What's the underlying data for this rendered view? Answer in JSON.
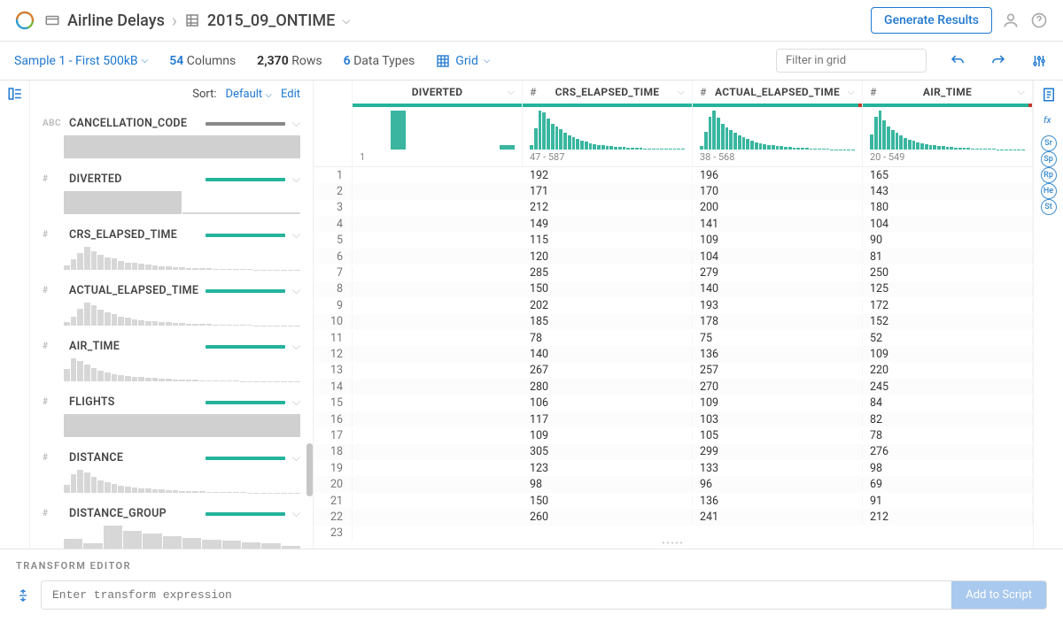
{
  "header": {
    "project": "Airline Delays",
    "dataset": "2015_09_ONTIME",
    "generate_label": "Generate Results"
  },
  "toolbar": {
    "sample": "Sample 1 - First 500kB",
    "cols_count": "54",
    "cols_label": "Columns",
    "rows_count": "2,370",
    "rows_label": "Rows",
    "types_count": "6",
    "types_label": "Data Types",
    "view_mode": "Grid",
    "filter_placeholder": "Filter in grid"
  },
  "sidebar": {
    "sort_label": "Sort:",
    "sort_value": "Default",
    "edit_label": "Edit",
    "items": [
      {
        "type": "ABC",
        "name": "CANCELLATION_CODE",
        "bar": "dk",
        "hist": [
          80
        ]
      },
      {
        "type": "#",
        "name": "DIVERTED",
        "hist": [
          60,
          5
        ]
      },
      {
        "type": "#",
        "name": "CRS_ELAPSED_TIME",
        "hist": [
          10,
          25,
          40,
          55,
          45,
          35,
          30,
          28,
          22,
          18,
          16,
          14,
          12,
          10,
          9,
          8,
          7,
          6,
          5,
          5,
          4,
          4,
          3,
          3,
          2,
          2,
          2,
          2,
          1,
          1,
          1,
          1,
          1,
          1,
          1
        ]
      },
      {
        "type": "#",
        "name": "ACTUAL_ELAPSED_TIME",
        "hist": [
          8,
          20,
          38,
          52,
          46,
          36,
          30,
          26,
          20,
          18,
          15,
          13,
          11,
          10,
          9,
          8,
          7,
          6,
          5,
          5,
          4,
          4,
          3,
          3,
          2,
          2,
          2,
          2,
          1,
          1,
          1,
          1,
          1,
          1,
          1
        ]
      },
      {
        "type": "#",
        "name": "AIR_TIME",
        "hist": [
          30,
          55,
          48,
          40,
          32,
          26,
          22,
          18,
          15,
          13,
          11,
          10,
          9,
          8,
          7,
          6,
          5,
          5,
          4,
          4,
          3,
          3,
          2,
          2,
          2,
          2,
          1,
          1,
          1,
          1,
          1,
          1,
          1,
          1,
          1
        ]
      },
      {
        "type": "#",
        "name": "FLIGHTS",
        "hist": [
          70
        ]
      },
      {
        "type": "#",
        "name": "DISTANCE",
        "hist": [
          20,
          45,
          55,
          48,
          38,
          30,
          26,
          22,
          18,
          15,
          13,
          11,
          10,
          9,
          8,
          7,
          6,
          5,
          5,
          4,
          4,
          3,
          3,
          2,
          2,
          2,
          2,
          1,
          1,
          1,
          1,
          1,
          1,
          1,
          1
        ]
      },
      {
        "type": "#",
        "name": "DISTANCE_GROUP",
        "hist": [
          30,
          15,
          70,
          55,
          45,
          38,
          32,
          28,
          24,
          20,
          16,
          8
        ]
      }
    ]
  },
  "grid": {
    "columns": [
      {
        "type": "",
        "name": "DIVERTED",
        "range": "1",
        "range_prefix": "",
        "hist": [
          0,
          0,
          92,
          0,
          0,
          0,
          0,
          0,
          0,
          10
        ],
        "tick": false
      },
      {
        "type": "#",
        "name": "CRS_ELAPSED_TIME",
        "range": "47 - 587",
        "hist": [
          10,
          45,
          82,
          78,
          65,
          55,
          48,
          42,
          36,
          30,
          26,
          22,
          19,
          16,
          14,
          12,
          10,
          9,
          8,
          7,
          6,
          5,
          5,
          4,
          4,
          3,
          3,
          2,
          2,
          2,
          2,
          1,
          1,
          1,
          1,
          1,
          1
        ],
        "tick": false
      },
      {
        "type": "#",
        "name": "ACTUAL_ELAPSED_TIME",
        "range": "38 - 568",
        "hist": [
          8,
          40,
          75,
          88,
          72,
          58,
          50,
          44,
          38,
          32,
          28,
          24,
          20,
          17,
          15,
          13,
          11,
          10,
          9,
          8,
          7,
          6,
          5,
          5,
          4,
          4,
          3,
          3,
          2,
          2,
          2,
          1,
          1,
          1,
          1,
          1,
          1
        ],
        "tick": true
      },
      {
        "type": "#",
        "name": "AIR_TIME",
        "range": "20 - 549",
        "hist": [
          35,
          78,
          92,
          70,
          55,
          46,
          40,
          34,
          28,
          24,
          20,
          17,
          15,
          13,
          11,
          10,
          9,
          8,
          7,
          6,
          5,
          5,
          4,
          4,
          3,
          3,
          2,
          2,
          2,
          2,
          1,
          1,
          1,
          1,
          1,
          1,
          1
        ],
        "tick": true
      }
    ],
    "rows": [
      {
        "n": 1,
        "v": [
          "",
          "192",
          "196",
          "165"
        ]
      },
      {
        "n": 2,
        "v": [
          "",
          "171",
          "170",
          "143"
        ]
      },
      {
        "n": 3,
        "v": [
          "",
          "212",
          "200",
          "180"
        ]
      },
      {
        "n": 4,
        "v": [
          "",
          "149",
          "141",
          "104"
        ]
      },
      {
        "n": 5,
        "v": [
          "",
          "115",
          "109",
          "90"
        ]
      },
      {
        "n": 6,
        "v": [
          "",
          "120",
          "104",
          "81"
        ]
      },
      {
        "n": 7,
        "v": [
          "",
          "285",
          "279",
          "250"
        ]
      },
      {
        "n": 8,
        "v": [
          "",
          "150",
          "140",
          "125"
        ]
      },
      {
        "n": 9,
        "v": [
          "",
          "202",
          "193",
          "172"
        ]
      },
      {
        "n": 10,
        "v": [
          "",
          "185",
          "178",
          "152"
        ]
      },
      {
        "n": 11,
        "v": [
          "",
          "78",
          "75",
          "52"
        ]
      },
      {
        "n": 12,
        "v": [
          "",
          "140",
          "136",
          "109"
        ]
      },
      {
        "n": 13,
        "v": [
          "",
          "267",
          "257",
          "220"
        ]
      },
      {
        "n": 14,
        "v": [
          "",
          "280",
          "270",
          "245"
        ]
      },
      {
        "n": 15,
        "v": [
          "",
          "106",
          "109",
          "84"
        ]
      },
      {
        "n": 16,
        "v": [
          "",
          "117",
          "103",
          "82"
        ]
      },
      {
        "n": 17,
        "v": [
          "",
          "109",
          "105",
          "78"
        ]
      },
      {
        "n": 18,
        "v": [
          "",
          "305",
          "299",
          "276"
        ]
      },
      {
        "n": 19,
        "v": [
          "",
          "123",
          "133",
          "98"
        ]
      },
      {
        "n": 20,
        "v": [
          "",
          "98",
          "96",
          "69"
        ]
      },
      {
        "n": 21,
        "v": [
          "",
          "150",
          "136",
          "91"
        ]
      },
      {
        "n": 22,
        "v": [
          "",
          "260",
          "241",
          "212"
        ]
      },
      {
        "n": 23,
        "v": [
          "",
          "",
          "",
          ""
        ]
      }
    ]
  },
  "rail_right": {
    "badges": [
      "Sr",
      "Sp",
      "Rp",
      "He",
      "St"
    ]
  },
  "footer": {
    "title": "TRANSFORM EDITOR",
    "placeholder": "Enter transform expression",
    "btn": "Add to Script"
  }
}
